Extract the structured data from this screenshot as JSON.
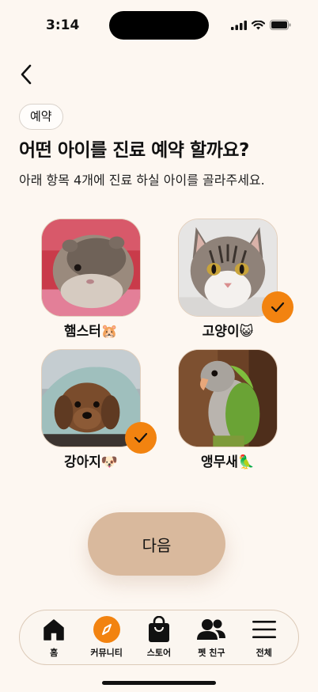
{
  "status": {
    "time": "3:14"
  },
  "header": {
    "chip": "예약",
    "title": "어떤 아이를 진료 예약 할까요?",
    "subtitle": "아래 항목 4개에 진료 하실 아이를 골라주세요."
  },
  "pets": [
    {
      "name": "햄스터🐹",
      "selected": false
    },
    {
      "name": "고양이😺",
      "selected": true
    },
    {
      "name": "강아지🐶",
      "selected": true
    },
    {
      "name": "앵무새🦜",
      "selected": false
    }
  ],
  "next_button": "다음",
  "tabs": [
    {
      "label": "홈",
      "icon": "home-icon"
    },
    {
      "label": "커뮤니티",
      "icon": "compass-icon"
    },
    {
      "label": "스토어",
      "icon": "shopping-bag-icon"
    },
    {
      "label": "펫 친구",
      "icon": "users-icon"
    },
    {
      "label": "전체",
      "icon": "menu-icon"
    }
  ],
  "colors": {
    "accent": "#f28310",
    "button": "#d9b99d",
    "background": "#fdf7f1"
  }
}
